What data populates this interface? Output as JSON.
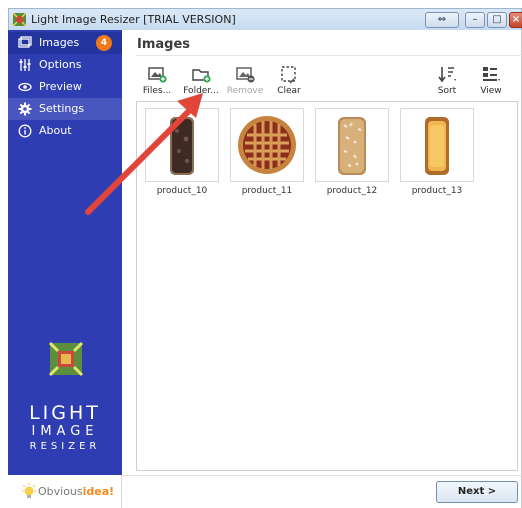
{
  "window": {
    "title": "Light Image Resizer  [TRIAL VERSION]",
    "controls": {
      "restore": "⇔",
      "minimize": "–",
      "maximize": "□",
      "close": "×"
    }
  },
  "sidebar": {
    "items": [
      {
        "label": "Images",
        "icon": "images-icon",
        "badge": "4"
      },
      {
        "label": "Options",
        "icon": "sliders-icon"
      },
      {
        "label": "Preview",
        "icon": "eye-icon"
      },
      {
        "label": "Settings",
        "icon": "gear-icon"
      },
      {
        "label": "About",
        "icon": "info-icon"
      }
    ],
    "logo": {
      "line1": "LIGHT",
      "line2": "IMAGE",
      "line3": "RESIZER"
    },
    "brand": {
      "prefix": "Obvious",
      "suffix": "idea!"
    }
  },
  "main": {
    "title": "Images",
    "toolbar": {
      "files": "Files...",
      "folder": "Folder...",
      "remove": "Remove",
      "clear": "Clear",
      "sort": "Sort",
      "view": "View"
    },
    "images": [
      {
        "name": "product_10",
        "kind": "chocolate-loaf"
      },
      {
        "name": "product_11",
        "kind": "lattice-pie"
      },
      {
        "name": "product_12",
        "kind": "almond-loaf"
      },
      {
        "name": "product_13",
        "kind": "pound-cake"
      }
    ],
    "next_label": "Next >"
  },
  "colors": {
    "sidebar": "#2e3eb2",
    "badge": "#f07a1a",
    "annotation_arrow": "#e2463b"
  }
}
